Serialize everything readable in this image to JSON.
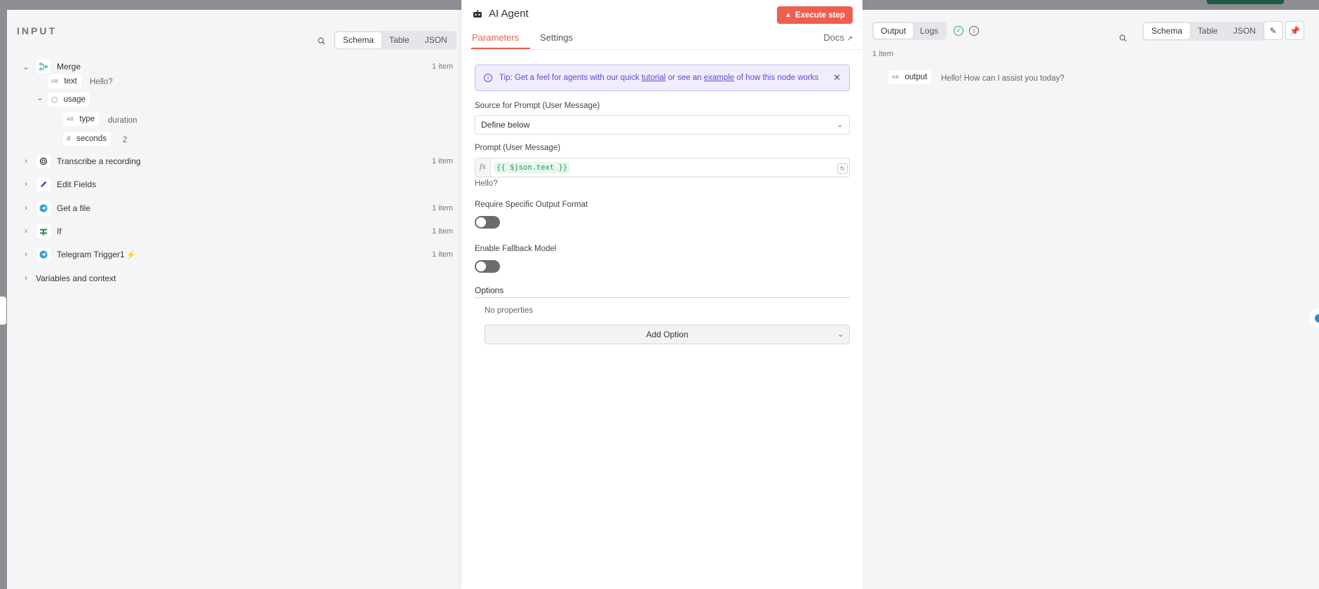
{
  "input_panel": {
    "title": "INPUT",
    "view_tabs": [
      "Schema",
      "Table",
      "JSON"
    ],
    "nodes": [
      {
        "name": "Merge",
        "count": "1 item",
        "expanded": true
      },
      {
        "name": "Transcribe a recording",
        "count": "1 item"
      },
      {
        "name": "Edit Fields",
        "count": ""
      },
      {
        "name": "Get a file",
        "count": "1 item"
      },
      {
        "name": "If",
        "count": "1 item"
      },
      {
        "name": "Telegram Trigger1",
        "count": "1 item"
      }
    ],
    "merge_fields": {
      "text": {
        "key": "text",
        "value": "Hello?"
      },
      "usage": {
        "key": "usage"
      },
      "type": {
        "key": "type",
        "value": "duration"
      },
      "seconds": {
        "key": "seconds",
        "value": "2"
      }
    },
    "variables_label": "Variables and context"
  },
  "node": {
    "title": "AI Agent",
    "execute_label": "Execute step",
    "tabs": {
      "parameters": "Parameters",
      "settings": "Settings",
      "docs": "Docs"
    },
    "tip": {
      "prefix": "Tip: Get a feel for agents with our quick ",
      "link1": "tutorial",
      "middle": " or see an ",
      "link2": "example",
      "suffix": " of how this node works"
    },
    "source_label": "Source for Prompt (User Message)",
    "source_value": "Define below",
    "prompt_label": "Prompt (User Message)",
    "prompt_expression": "{{ $json.text }}",
    "prompt_preview": "Hello?",
    "output_format_label": "Require Specific Output Format",
    "output_format_enabled": false,
    "fallback_label": "Enable Fallback Model",
    "fallback_enabled": false,
    "options_title": "Options",
    "no_properties": "No properties",
    "add_option": "Add Option"
  },
  "output_panel": {
    "tabs": [
      "Output",
      "Logs"
    ],
    "view_tabs": [
      "Schema",
      "Table",
      "JSON"
    ],
    "count": "1 item",
    "field": {
      "key": "output",
      "value": "Hello! How can I assist you today?"
    }
  },
  "colors": {
    "accent": "#ee5e4f",
    "tip": "#6349d6",
    "success": "#2ea86a"
  }
}
